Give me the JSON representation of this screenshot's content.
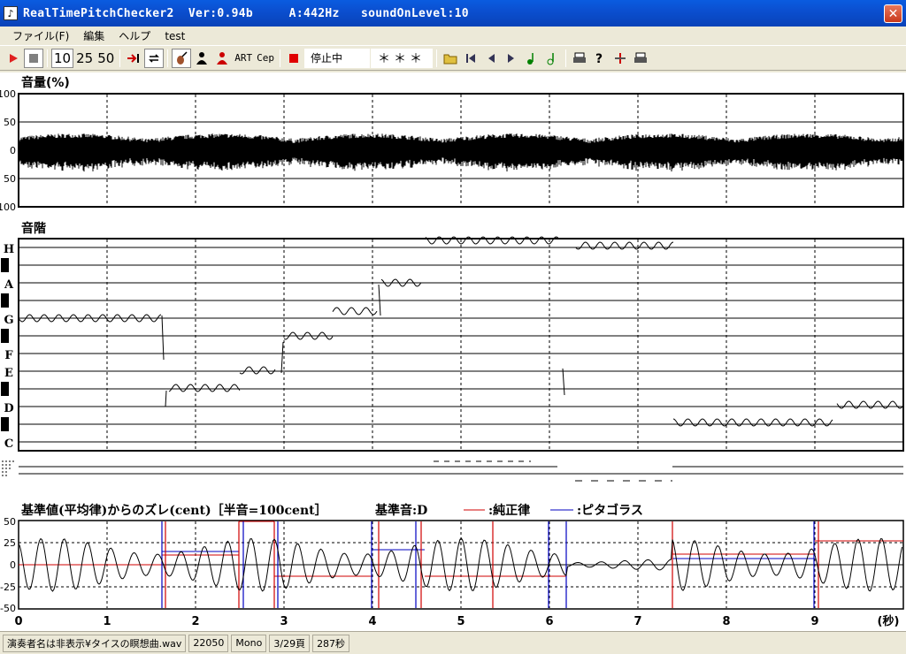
{
  "window": {
    "title": "RealTimePitchChecker2  Ver:0.94b     A:442Hz   soundOnLevel:10",
    "close_icon": "✕"
  },
  "menu": [
    "ファイル(F)",
    "編集",
    "ヘルプ",
    "test"
  ],
  "toolbar": {
    "play_icon": "play-icon",
    "stop_icon": "stop-icon",
    "num_10": "10",
    "num_25": "25",
    "num_50": "50",
    "art_label": "ART",
    "cep_label": "Cep",
    "status": "停止中",
    "stars": "＊＊＊",
    "colors": {
      "play": "#e02020",
      "stop": "#808080",
      "record": "#e00000",
      "note_green": "#008000"
    }
  },
  "volume_panel": {
    "title": "音量(%)",
    "y_ticks": [
      "100",
      "50",
      "0",
      "50",
      "100"
    ]
  },
  "scale_panel": {
    "title": "音階",
    "note_labels": [
      "H",
      "A",
      "G",
      "F",
      "E",
      "D",
      "C"
    ]
  },
  "deviation_panel": {
    "title": "基準値(平均律)からのズレ(cent)［半音=100cent］",
    "base_note": "基準音:D",
    "legend_just": ":純正律",
    "legend_pyth": ":ピタゴラス",
    "y_ticks": [
      "50",
      "25",
      "0",
      "-25",
      "-50"
    ],
    "colors": {
      "just": "#d00000",
      "pyth": "#0000c0",
      "wave": "#000000"
    }
  },
  "time_axis": {
    "ticks": [
      "0",
      "1",
      "2",
      "3",
      "4",
      "5",
      "6",
      "7",
      "8",
      "9"
    ],
    "unit": "(秒)"
  },
  "statusbar": {
    "filename": "演奏者名は非表示¥タイスの瞑想曲.wav",
    "rate": "22050",
    "channel": "Mono",
    "page": "3/29頁",
    "seconds": "287秒"
  }
}
